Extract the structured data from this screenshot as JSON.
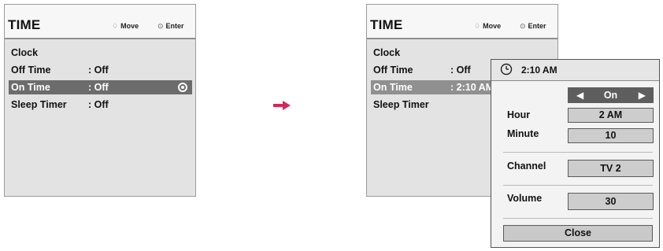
{
  "left_menu": {
    "title": "TIME",
    "hint_move": "Move",
    "hint_enter": "Enter",
    "items": [
      {
        "label": "Clock",
        "value": ""
      },
      {
        "label": "Off Time",
        "value": ": Off"
      },
      {
        "label": "On Time",
        "value": ": Off"
      },
      {
        "label": "Sleep Timer",
        "value": ": Off"
      }
    ]
  },
  "right_menu": {
    "title": "TIME",
    "hint_move": "Move",
    "hint_enter": "Enter",
    "items": [
      {
        "label": "Clock",
        "value": ""
      },
      {
        "label": "Off Time",
        "value": ": Off"
      },
      {
        "label": "On Time",
        "value": ": 2:10 AM"
      },
      {
        "label": "Sleep Timer",
        "value": ""
      }
    ]
  },
  "popup": {
    "title": "2:10 AM",
    "onoff_value": "On",
    "hour_label": "Hour",
    "hour_value": "2 AM",
    "minute_label": "Minute",
    "minute_value": "10",
    "channel_label": "Channel",
    "channel_value": "TV 2",
    "volume_label": "Volume",
    "volume_value": "30",
    "close_label": "Close"
  },
  "glyphs": {
    "move": "♢",
    "enter": "⊙",
    "left": "◀",
    "right": "▶"
  },
  "colors": {
    "selected_row": "#6c6c6c",
    "arrow": "#d6265a"
  }
}
